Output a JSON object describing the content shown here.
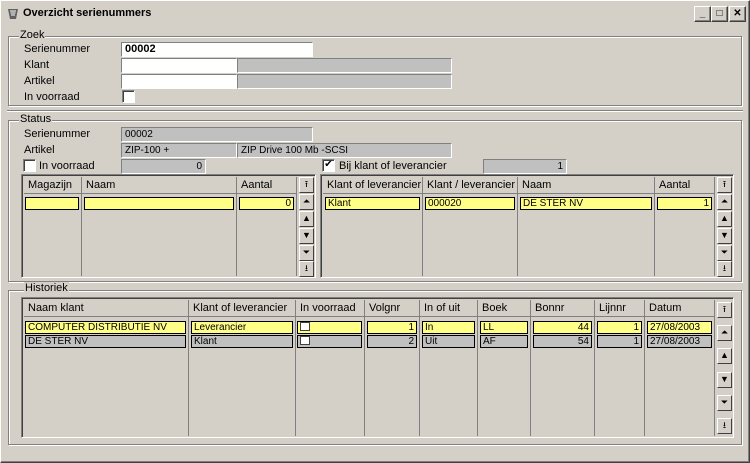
{
  "window": {
    "title": "Overzicht serienummers",
    "min": "_",
    "max": "□",
    "close": "✕"
  },
  "zoek": {
    "legend": "Zoek",
    "serienummer_label": "Serienummer",
    "serienummer_value": "00002",
    "klant_label": "Klant",
    "klant_code": "",
    "klant_name": "",
    "artikel_label": "Artikel",
    "artikel_code": "",
    "artikel_name": "",
    "voorraad_label": "In voorraad"
  },
  "status": {
    "legend": "Status",
    "serienummer_label": "Serienummer",
    "serienummer_value": "00002",
    "artikel_label": "Artikel",
    "artikel_code": "ZIP-100 +",
    "artikel_name": "ZIP Drive 100 Mb -SCSI",
    "voorraad_label": "In voorraad",
    "voorraad_count": "0",
    "bij_klant_label": "Bij klant of leverancier",
    "bij_klant_checked": "✔",
    "bij_klant_count": "1"
  },
  "magazijn_grid": {
    "headers": [
      "Magazijn",
      "Naam",
      "Aantal"
    ],
    "rows": [
      [
        "",
        "",
        "0"
      ]
    ]
  },
  "klant_grid": {
    "headers": [
      "Klant of leverancier",
      "Klant / leverancier",
      "Naam",
      "Aantal"
    ],
    "rows": [
      [
        "Klant",
        "000020",
        "DE STER NV",
        "1"
      ]
    ]
  },
  "historiek": {
    "legend": "Historiek",
    "headers": [
      "Naam klant",
      "Klant of leverancier",
      "In voorraad",
      "Volgnr",
      "In of uit",
      "Boek",
      "Bonnr",
      "Lijnnr",
      "Datum"
    ],
    "rows": [
      {
        "naam": "COMPUTER DISTRIBUTIE NV",
        "kl": "Leverancier",
        "volgnr": "1",
        "inuit": "In",
        "boek": "LL",
        "bonnr": "44",
        "lijnnr": "1",
        "datum": "27/08/2003"
      },
      {
        "naam": "DE STER NV",
        "kl": "Klant",
        "volgnr": "2",
        "inuit": "Uit",
        "boek": "AF",
        "bonnr": "54",
        "lijnnr": "1",
        "datum": "27/08/2003"
      }
    ]
  },
  "scroll_icons": {
    "top": "⭱",
    "page_up": "⏶",
    "up": "▲",
    "down": "▼",
    "page_down": "⏷",
    "bottom": "⭳"
  },
  "colors": {
    "highlight": "#ffff88",
    "face": "#d4d0c8",
    "readonly": "#c0c0c0"
  }
}
